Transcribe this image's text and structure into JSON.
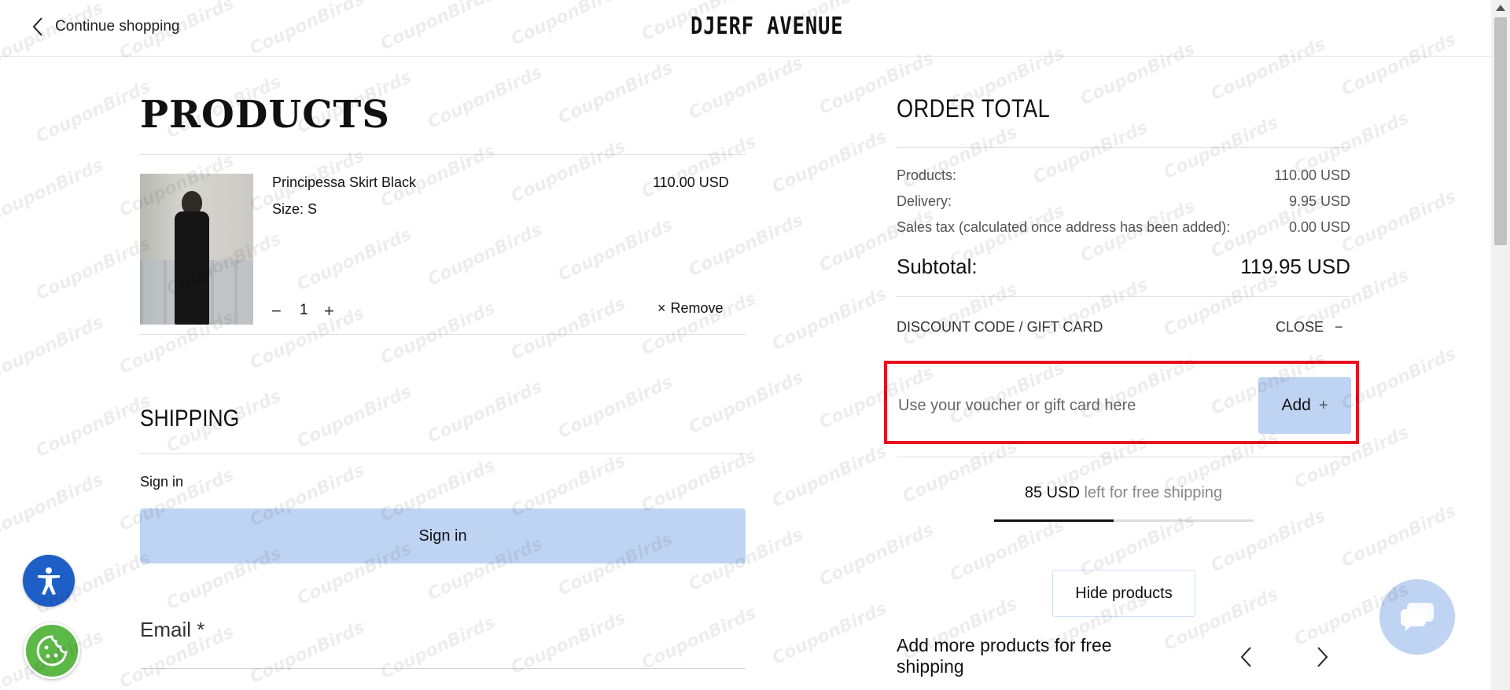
{
  "header": {
    "back_label": "Continue shopping",
    "logo": "DJERF AVENUE"
  },
  "products": {
    "title": "PRODUCTS",
    "item": {
      "name": "Principessa Skirt Black",
      "size": "Size: S",
      "price": "110.00 USD",
      "quantity": "1",
      "minus": "−",
      "plus": "+",
      "remove_label": "Remove",
      "remove_icon": "×"
    }
  },
  "shipping": {
    "title": "SHIPPING",
    "signin_label": "Sign in",
    "signin_button": "Sign in",
    "email_label": "Email *"
  },
  "order": {
    "title": "ORDER TOTAL",
    "rows": [
      {
        "label": "Products:",
        "value": "110.00 USD"
      },
      {
        "label": "Delivery:",
        "value": "9.95 USD"
      },
      {
        "label": "Sales tax (calculated once address has been added):",
        "value": "0.00 USD"
      }
    ],
    "subtotal_label": "Subtotal:",
    "subtotal_value": "119.95 USD",
    "discount_label": "DISCOUNT CODE / GIFT CARD",
    "discount_close": "CLOSE",
    "discount_close_icon": "−",
    "voucher_placeholder": "Use your voucher or gift card here",
    "voucher_add": "Add",
    "voucher_add_icon": "+",
    "free_shipping_amount": "85 USD",
    "free_shipping_rest": "left for free shipping",
    "free_shipping_progress": 0.46,
    "hide_products": "Hide products",
    "add_more": "Add more products for free shipping"
  },
  "watermark": "CouponBirds",
  "colors": {
    "accent_blue": "#bfd3f3",
    "highlight_red": "#e8101c",
    "accessibility_blue": "#1e5fc7",
    "cookie_green": "#5cb847"
  },
  "icons": {
    "back": "chevron-left-icon",
    "carousel_prev": "chevron-left-icon",
    "carousel_next": "chevron-right-icon",
    "accessibility": "accessibility-icon",
    "cookie": "cookie-icon",
    "chat": "chat-icon"
  }
}
